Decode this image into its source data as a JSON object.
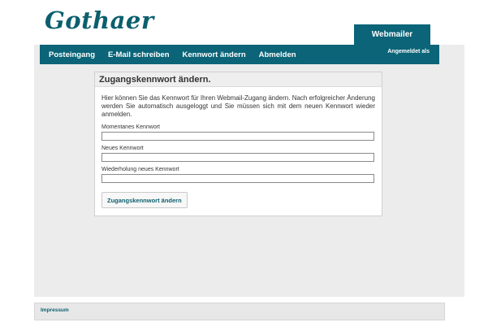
{
  "brand": {
    "logo_text": "Gothaer"
  },
  "header": {
    "webmailer_tab": "Webmailer",
    "status_text": "Angemeldet als"
  },
  "nav": {
    "items": [
      {
        "label": "Posteingang"
      },
      {
        "label": "E-Mail schreiben"
      },
      {
        "label": "Kennwort ändern"
      },
      {
        "label": "Abmelden"
      }
    ]
  },
  "form": {
    "title": "Zugangskennwort ändern.",
    "intro": "Hier können Sie das Kennwort für Ihren Webmail-Zugang ändern. Nach erfolgreicher Änderung werden Sie automatisch ausgeloggt und Sie müssen sich mit dem neuen Kennwort wieder anmelden.",
    "fields": [
      {
        "label": "Momentanes Kennwort",
        "value": ""
      },
      {
        "label": "Neues Kennwort",
        "value": ""
      },
      {
        "label": "Wiederholung neues Kennwort",
        "value": ""
      }
    ],
    "submit_label": "Zugangskennwort ändern"
  },
  "footer": {
    "link": "Impressum"
  },
  "colors": {
    "primary": "#0b6478",
    "logo": "#0b5f6e",
    "page_bg": "#ececec"
  }
}
